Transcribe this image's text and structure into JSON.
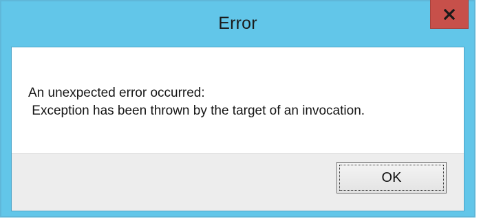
{
  "dialog": {
    "title": "Error",
    "message_line1": "An unexpected error occurred:",
    "message_line2": " Exception has been thrown by the target of an invocation.",
    "ok_label": "OK",
    "close_icon": "close-icon"
  },
  "colors": {
    "titlebar": "#62c6e9",
    "close_button": "#c7504a",
    "client_background": "#ffffff",
    "button_bar": "#ededed"
  }
}
